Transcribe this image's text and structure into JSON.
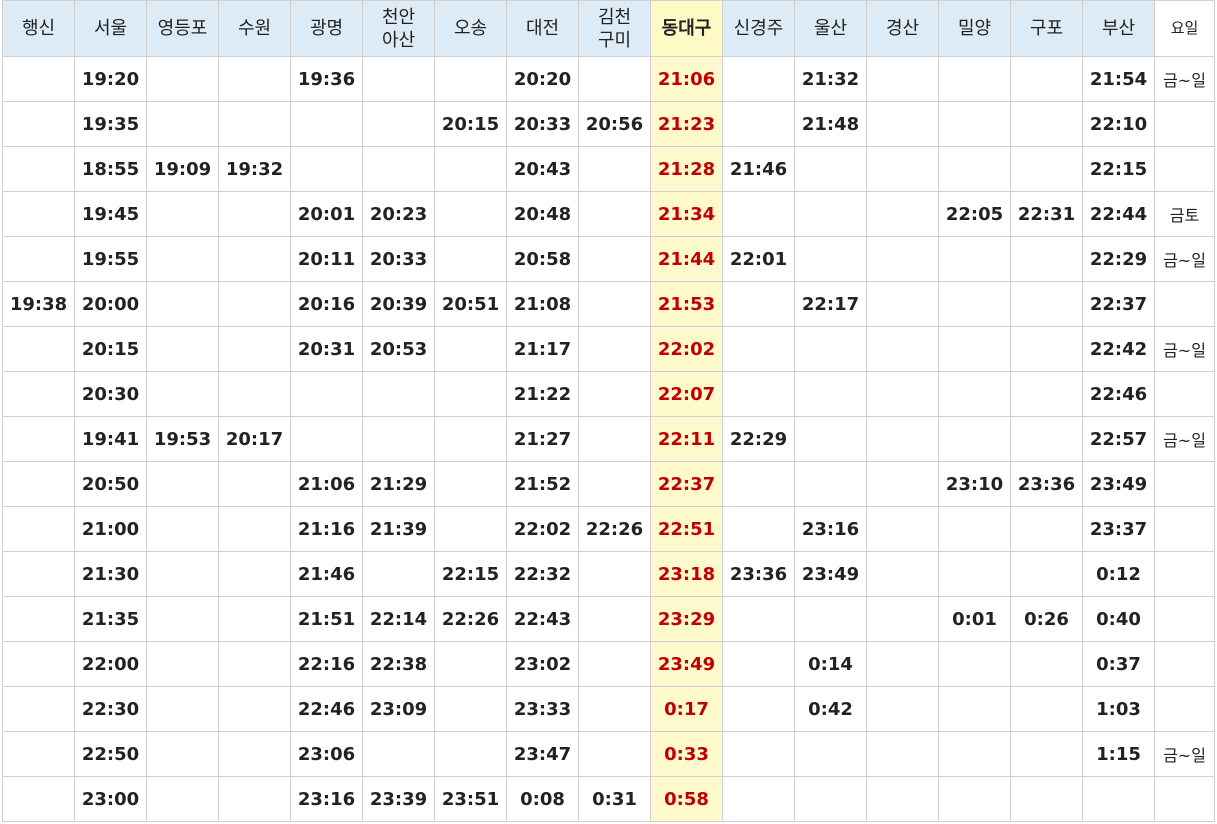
{
  "header": [
    "행신",
    "서울",
    "영등포",
    "수원",
    "광명",
    "천안\n아산",
    "오송",
    "대전",
    "김천\n구미",
    "동대구",
    "신경주",
    "울산",
    "경산",
    "밀양",
    "구포",
    "부산",
    "요일"
  ],
  "highlight_column": "동대구",
  "colors": {
    "header_bg": "#dcebf6",
    "highlight_bg": "#fffacd",
    "highlight_text": "#c00000",
    "border": "#d0d0d0"
  },
  "rows": [
    [
      "",
      "19:20",
      "",
      "",
      "19:36",
      "",
      "",
      "20:20",
      "",
      "21:06",
      "",
      "21:32",
      "",
      "",
      "",
      "21:54",
      "금~일"
    ],
    [
      "",
      "19:35",
      "",
      "",
      "",
      "",
      "20:15",
      "20:33",
      "20:56",
      "21:23",
      "",
      "21:48",
      "",
      "",
      "",
      "22:10",
      ""
    ],
    [
      "",
      "18:55",
      "19:09",
      "19:32",
      "",
      "",
      "",
      "20:43",
      "",
      "21:28",
      "21:46",
      "",
      "",
      "",
      "",
      "22:15",
      ""
    ],
    [
      "",
      "19:45",
      "",
      "",
      "20:01",
      "20:23",
      "",
      "20:48",
      "",
      "21:34",
      "",
      "",
      "",
      "22:05",
      "22:31",
      "22:44",
      "금토"
    ],
    [
      "",
      "19:55",
      "",
      "",
      "20:11",
      "20:33",
      "",
      "20:58",
      "",
      "21:44",
      "22:01",
      "",
      "",
      "",
      "",
      "22:29",
      "금~일"
    ],
    [
      "19:38",
      "20:00",
      "",
      "",
      "20:16",
      "20:39",
      "20:51",
      "21:08",
      "",
      "21:53",
      "",
      "22:17",
      "",
      "",
      "",
      "22:37",
      ""
    ],
    [
      "",
      "20:15",
      "",
      "",
      "20:31",
      "20:53",
      "",
      "21:17",
      "",
      "22:02",
      "",
      "",
      "",
      "",
      "",
      "22:42",
      "금~일"
    ],
    [
      "",
      "20:30",
      "",
      "",
      "",
      "",
      "",
      "21:22",
      "",
      "22:07",
      "",
      "",
      "",
      "",
      "",
      "22:46",
      ""
    ],
    [
      "",
      "19:41",
      "19:53",
      "20:17",
      "",
      "",
      "",
      "21:27",
      "",
      "22:11",
      "22:29",
      "",
      "",
      "",
      "",
      "22:57",
      "금~일"
    ],
    [
      "",
      "20:50",
      "",
      "",
      "21:06",
      "21:29",
      "",
      "21:52",
      "",
      "22:37",
      "",
      "",
      "",
      "23:10",
      "23:36",
      "23:49",
      ""
    ],
    [
      "",
      "21:00",
      "",
      "",
      "21:16",
      "21:39",
      "",
      "22:02",
      "22:26",
      "22:51",
      "",
      "23:16",
      "",
      "",
      "",
      "23:37",
      ""
    ],
    [
      "",
      "21:30",
      "",
      "",
      "21:46",
      "",
      "22:15",
      "22:32",
      "",
      "23:18",
      "23:36",
      "23:49",
      "",
      "",
      "",
      "0:12",
      ""
    ],
    [
      "",
      "21:35",
      "",
      "",
      "21:51",
      "22:14",
      "22:26",
      "22:43",
      "",
      "23:29",
      "",
      "",
      "",
      "0:01",
      "0:26",
      "0:40",
      ""
    ],
    [
      "",
      "22:00",
      "",
      "",
      "22:16",
      "22:38",
      "",
      "23:02",
      "",
      "23:49",
      "",
      "0:14",
      "",
      "",
      "",
      "0:37",
      ""
    ],
    [
      "",
      "22:30",
      "",
      "",
      "22:46",
      "23:09",
      "",
      "23:33",
      "",
      "0:17",
      "",
      "0:42",
      "",
      "",
      "",
      "1:03",
      ""
    ],
    [
      "",
      "22:50",
      "",
      "",
      "23:06",
      "",
      "",
      "23:47",
      "",
      "0:33",
      "",
      "",
      "",
      "",
      "",
      "1:15",
      "금~일"
    ],
    [
      "",
      "23:00",
      "",
      "",
      "23:16",
      "23:39",
      "23:51",
      "0:08",
      "0:31",
      "0:58",
      "",
      "",
      "",
      "",
      "",
      "",
      ""
    ]
  ]
}
